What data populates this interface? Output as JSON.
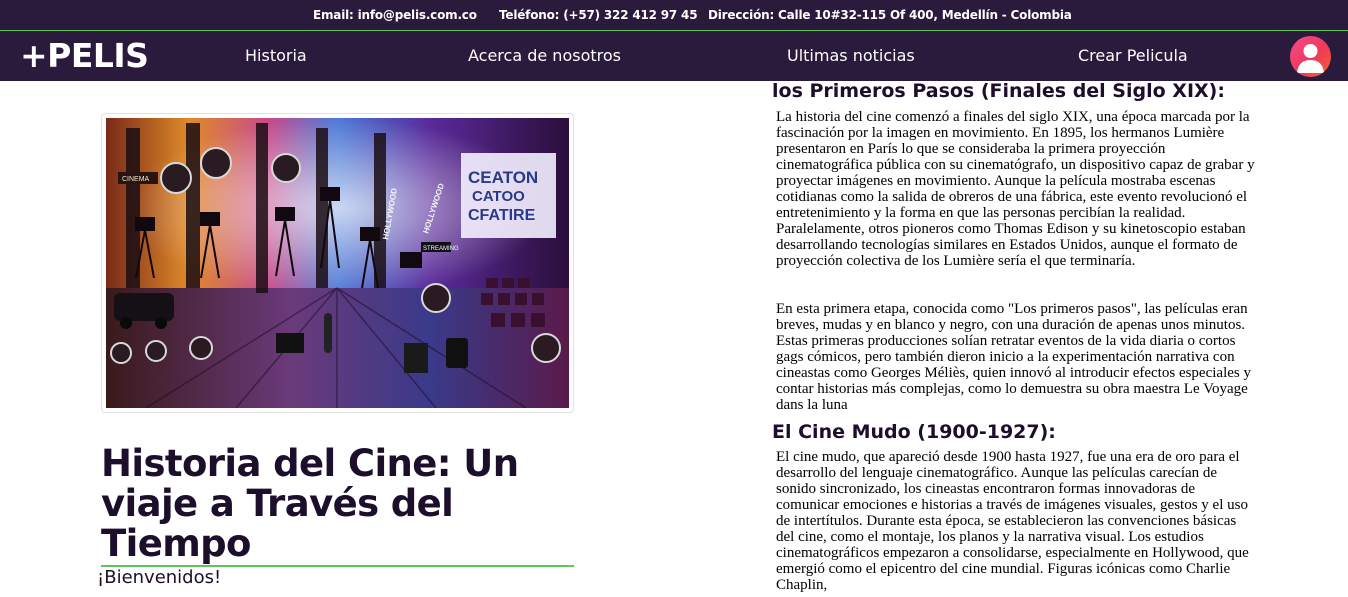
{
  "topbar": {
    "email": "Email: info@pelis.com.co",
    "phone": "Teléfono: (+57) 322 412 97 45",
    "address": "Dirección: Calle 10#32-115 Of 400, Medellín - Colombia"
  },
  "navbar": {
    "logo": "+PELIS",
    "links": [
      "Historia",
      "Acerca de nosotros",
      "Ultimas noticias",
      "Crear Pelicula"
    ],
    "avatar_icon": "user-avatar-icon"
  },
  "hero": {
    "image_labels": {
      "cinema": "CINEMA",
      "hollywood1": "HOLLYWOOD",
      "hollywood2": "HOLLYWOOD",
      "streaming": "STREAMING",
      "marquee": [
        "CEATON",
        "CATOO",
        "CFATIRE"
      ]
    },
    "title": "Historia del Cine: Un viaje a Través del Tiempo",
    "welcome": "¡Bienvenidos!"
  },
  "sections": [
    {
      "title": "los Primeros Pasos (Finales del Siglo XIX):",
      "paragraphs": [
        "La historia del cine comenzó a finales del siglo XIX, una época marcada por la fascinación por la imagen en movimiento. En 1895, los hermanos Lumière presentaron en París lo que se consideraba la primera proyección cinematográfica pública con su cinematógrafo, un dispositivo capaz de grabar y proyectar imágenes en movimiento. Aunque la película mostraba escenas cotidianas como la salida de obreros de una fábrica, este evento revolucionó el entretenimiento y la forma en que las personas percibían la realidad. Paralelamente, otros pioneros como Thomas Edison y su kinetoscopio estaban desarrollando tecnologías similares en Estados Unidos, aunque el formato de proyección colectiva de los Lumière sería el que terminaría.",
        "En esta primera etapa, conocida como \"Los primeros pasos\", las películas eran breves, mudas y en blanco y negro, con una duración de apenas unos minutos. Estas primeras producciones solían retratar eventos de la vida diaria o cortos gags cómicos, pero también dieron inicio a la experimentación narrativa con cineastas como Georges Méliès, quien innovó al introducir efectos especiales y contar historias más complejas, como lo demuestra su obra maestra Le Voyage dans la luna"
      ]
    },
    {
      "title": "El Cine Mudo (1900-1927):",
      "paragraphs": [
        "El cine mudo, que apareció desde 1900 hasta 1927, fue una era de oro para el desarrollo del lenguaje cinematográfico. Aunque las películas carecían de sonido sincronizado, los cineastas encontraron formas innovadoras de comunicar emociones e historias a través de imágenes visuales, gestos y el uso de intertítulos. Durante esta época, se establecieron las convenciones básicas del cine, como el montaje, los planos y la narrativa visual. Los estudios cinematográficos empezaron a consolidarse, especialmente en Hollywood, que emergió como el epicentro del cine mundial. Figuras icónicas como Charlie Chaplin,"
      ]
    }
  ]
}
